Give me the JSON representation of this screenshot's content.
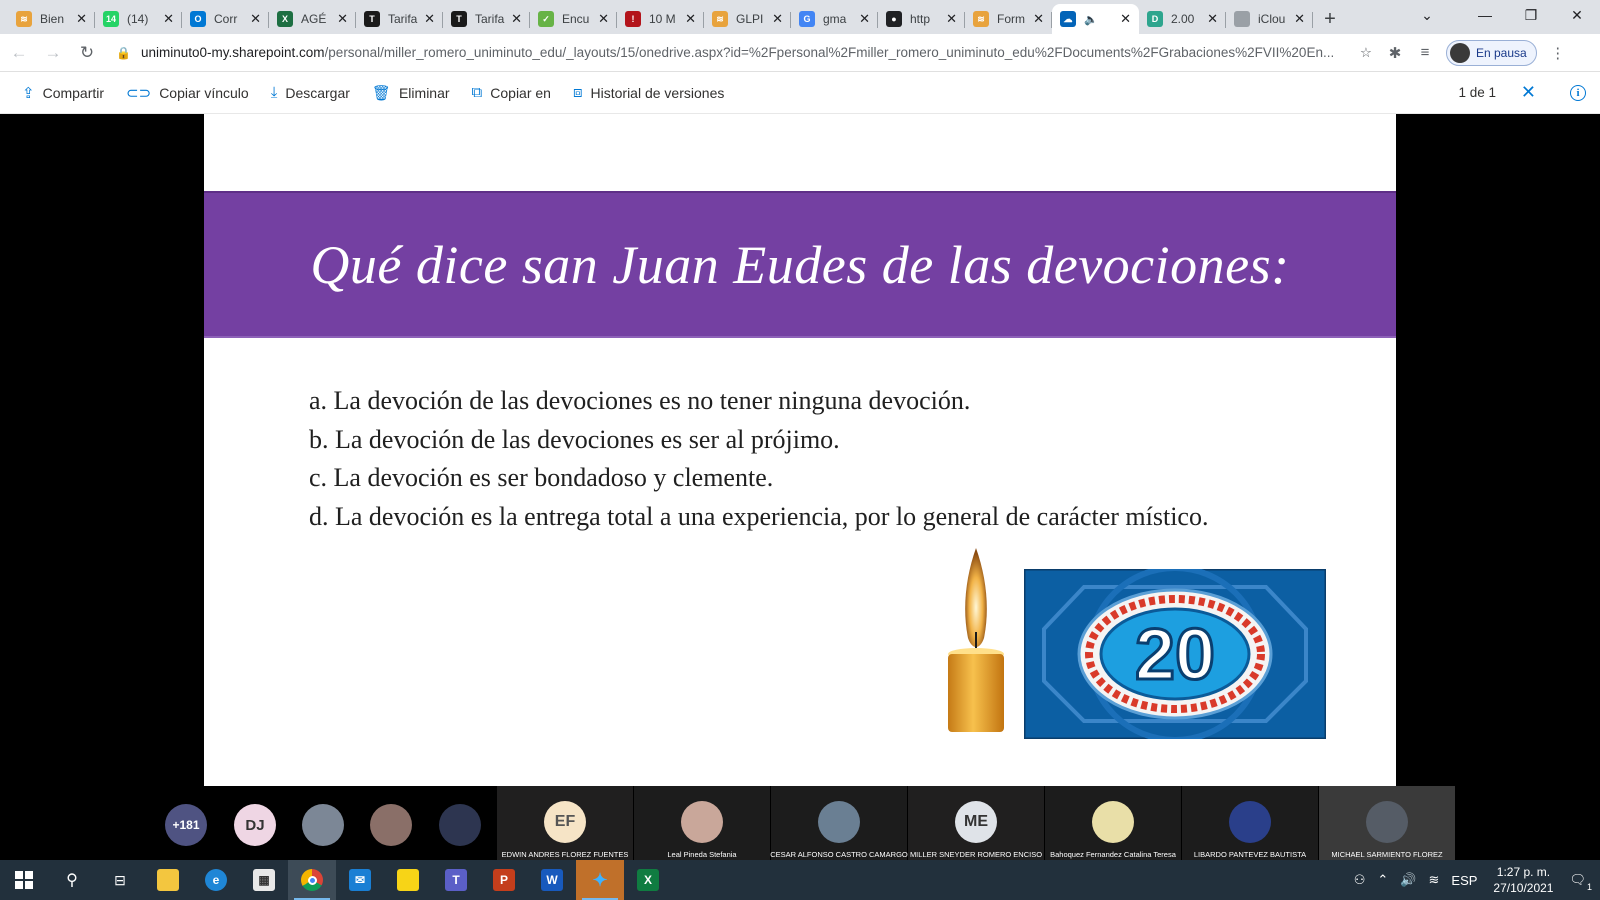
{
  "browser": {
    "tabs": [
      {
        "title": "Bien",
        "favicon_color": "#e8a33d",
        "favicon": "≋"
      },
      {
        "title": "(14)",
        "favicon_color": "#25d366",
        "favicon": "14"
      },
      {
        "title": "Corr",
        "favicon_color": "#0078d4",
        "favicon": "O"
      },
      {
        "title": "AGÉ",
        "favicon_color": "#1d6f42",
        "favicon": "X"
      },
      {
        "title": "Tarifa",
        "favicon_color": "#1a1a1a",
        "favicon": "T"
      },
      {
        "title": "Tarifa",
        "favicon_color": "#1a1a1a",
        "favicon": "T"
      },
      {
        "title": "Encu",
        "favicon_color": "#67b346",
        "favicon": "✓"
      },
      {
        "title": "10 M",
        "favicon_color": "#b3141b",
        "favicon": "!"
      },
      {
        "title": "GLPI",
        "favicon_color": "#e8a33d",
        "favicon": "≋"
      },
      {
        "title": "gma",
        "favicon_color": "#4285f4",
        "favicon": "G"
      },
      {
        "title": "http",
        "favicon_color": "#202124",
        "favicon": "●"
      },
      {
        "title": "Form",
        "favicon_color": "#e8a33d",
        "favicon": "≋"
      },
      {
        "title": "",
        "favicon_color": "#0364b8",
        "favicon": "☁",
        "active": true,
        "audio": "🔈"
      },
      {
        "title": "2.00",
        "favicon_color": "#2ea58e",
        "favicon": "D"
      },
      {
        "title": "iClou",
        "favicon_color": "#9aa0a6",
        "favicon": ""
      }
    ],
    "url_host": "uniminuto0-my.sharepoint.com",
    "url_path": "/personal/miller_romero_uniminuto_edu/_layouts/15/onedrive.aspx?id=%2Fpersonal%2Fmiller_romero_uniminuto_edu%2FDocuments%2FGrabaciones%2FVII%20En...",
    "profile_label": "En pausa"
  },
  "toolbar": {
    "share": "Compartir",
    "copy_link": "Copiar vínculo",
    "download": "Descargar",
    "delete": "Eliminar",
    "copy_to": "Copiar en",
    "version_history": "Historial de versiones",
    "pager": "1 de 1"
  },
  "slide": {
    "title": "Qué dice san Juan Eudes de las devociones:",
    "options": [
      "a. La devoción de las devociones es no tener ninguna devoción.",
      "b. La devoción de las devociones es ser al prójimo.",
      "c. La devoción es ser bondadoso y clemente.",
      "d. La devoción es la entrega total a una experiencia, por lo general de carácter místico."
    ],
    "timer_value": "20",
    "band_color": "#7440a2"
  },
  "participants": {
    "overflow_count": "+181",
    "initials": [
      {
        "text": "DJ",
        "bg": "#efd6e4",
        "fg": "#333"
      }
    ],
    "tiles": [
      {
        "name": "EDWIN ANDRES FLOREZ FUENTES",
        "initials": "EF",
        "bg": "#f6e4c6",
        "fg": "#555"
      },
      {
        "name": "Leal Pineda Stefania",
        "initials": "",
        "bg": "#c9a79a",
        "fg": "#fff"
      },
      {
        "name": "CESAR ALFONSO CASTRO CAMARGO",
        "initials": "",
        "bg": "#6a7f93",
        "fg": "#fff"
      },
      {
        "name": "MILLER SNEYDER ROMERO ENCISO",
        "initials": "ME",
        "bg": "#dfe3e8",
        "fg": "#333"
      },
      {
        "name": "Bahoquez Fernandez Catalina Teresa",
        "initials": "",
        "bg": "#e9dfa8",
        "fg": "#fff"
      },
      {
        "name": "LIBARDO PANTEVEZ BAUTISTA",
        "initials": "",
        "bg": "#2a3f8a",
        "fg": "#fff"
      },
      {
        "name": "MICHAEL SARMIENTO FLOREZ",
        "initials": "",
        "bg": "#555c66",
        "fg": "#fff"
      }
    ]
  },
  "taskbar": {
    "language": "ESP",
    "time": "1:27 p. m.",
    "date": "27/10/2021",
    "notif_count": "1"
  }
}
